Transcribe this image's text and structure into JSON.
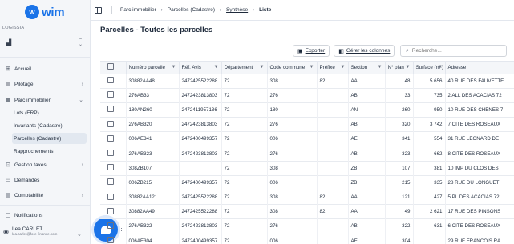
{
  "app": {
    "brand": "wim"
  },
  "sidebar": {
    "org_label": "LOGISSIA",
    "nav": [
      {
        "label": "Accueil"
      },
      {
        "label": "Pilotage"
      },
      {
        "label": "Parc immobilier"
      }
    ],
    "sub": [
      {
        "label": "Lots (ERP)"
      },
      {
        "label": "Invariants (Cadastre)"
      },
      {
        "label": "Parcelles (Cadastre)"
      },
      {
        "label": "Rapprochements"
      }
    ],
    "nav2": [
      {
        "label": "Gestion taxes"
      },
      {
        "label": "Demandes"
      },
      {
        "label": "Comptabilité"
      },
      {
        "label": "Notifications"
      }
    ],
    "user": {
      "name": "Lea CARLET",
      "email": "lea.carlet@fore-finance.com"
    }
  },
  "breadcrumb": [
    "Parc immobilier",
    "Parcelles (Cadastre)",
    "Synthèse",
    "Liste"
  ],
  "page": {
    "title": "Parcelles - Toutes les parcelles"
  },
  "toolbar": {
    "export_label": "Exporter",
    "columns_label": "Gérer les colonnes",
    "search_placeholder": "Recherche..."
  },
  "table": {
    "columns": [
      "Numéro parcelle",
      "Réf. Avis",
      "Département",
      "Code commune",
      "Préfixe",
      "Section",
      "N° plan",
      "Surface (m²)",
      "Adresse"
    ],
    "rows": [
      [
        "30882AA48",
        "2472425522288",
        "72",
        "308",
        "82",
        "AA",
        "48",
        "5 656",
        "40 RUE DES FAUVETTE"
      ],
      [
        "276AB33",
        "2472423813803",
        "72",
        "276",
        "",
        "AB",
        "33",
        "735",
        "2 ALL DES ACACIAS 72"
      ],
      [
        "180AN260",
        "2472411957136",
        "72",
        "180",
        "",
        "AN",
        "260",
        "950",
        "10 RUE DES CHENES 7"
      ],
      [
        "276AB320",
        "2472423813803",
        "72",
        "276",
        "",
        "AB",
        "320",
        "3 742",
        "7 CITE DES ROSEAUX"
      ],
      [
        "006AE341",
        "2472400499357",
        "72",
        "006",
        "",
        "AE",
        "341",
        "554",
        "31 RUE LEONARD DE"
      ],
      [
        "276AB323",
        "2472423813803",
        "72",
        "276",
        "",
        "AB",
        "323",
        "662",
        "8 CITE DES ROSEAUX"
      ],
      [
        "308ZB107",
        "",
        "72",
        "308",
        "",
        "ZB",
        "107",
        "381",
        "10 IMP DU CLOS DES"
      ],
      [
        "006ZB215",
        "2472400499357",
        "72",
        "006",
        "",
        "ZB",
        "215",
        "335",
        "28 RUE DU LONGUET"
      ],
      [
        "30882AA121",
        "2472425522288",
        "72",
        "308",
        "82",
        "AA",
        "121",
        "427",
        "5 PL DES ACACIAS 72"
      ],
      [
        "30882AA49",
        "2472425522288",
        "72",
        "308",
        "82",
        "AA",
        "49",
        "2 621",
        "17 RUE DES PINSONS"
      ],
      [
        "276AB322",
        "2472423813803",
        "72",
        "276",
        "",
        "AB",
        "322",
        "631",
        "6 CITE DES ROSEAUX"
      ],
      [
        "006AE304",
        "2472400499357",
        "72",
        "006",
        "",
        "AE",
        "304",
        "",
        "29 RUE FRANCOIS RA"
      ]
    ]
  }
}
